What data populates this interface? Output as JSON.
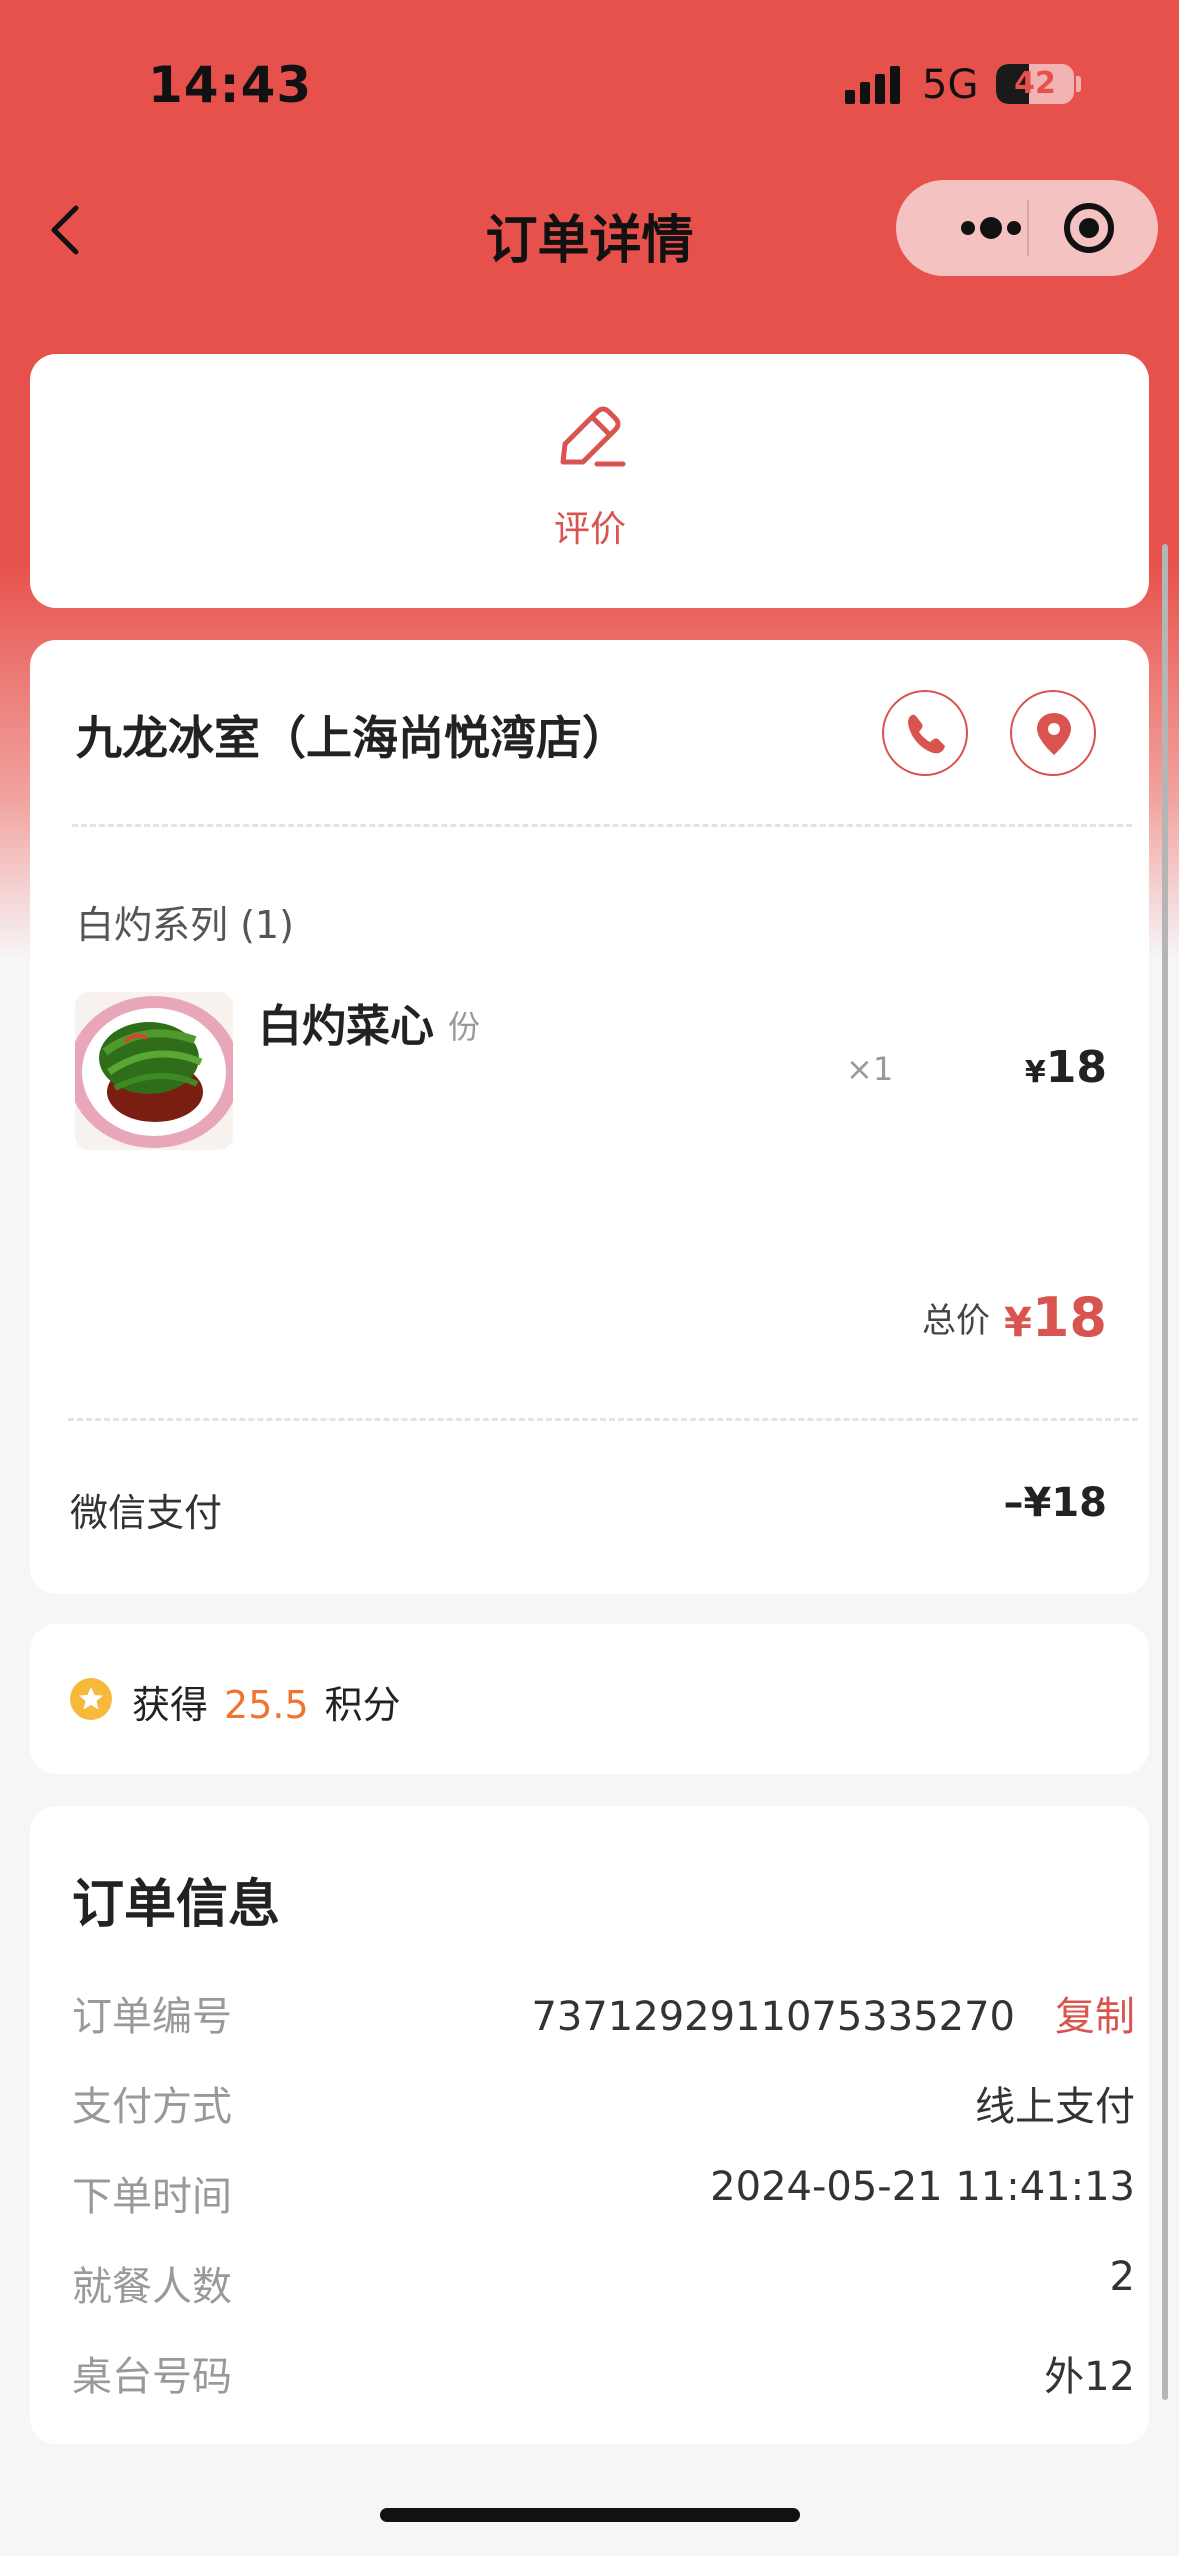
{
  "status_bar": {
    "time": "14:43",
    "network": "5G",
    "battery": "42",
    "battery_level": 0.42
  },
  "nav": {
    "title": "订单详情",
    "back_icon": "chevron-left-icon",
    "more_icon": "more-dots-icon",
    "close_icon": "target-circle-icon"
  },
  "review": {
    "label": "评价",
    "icon": "edit-icon"
  },
  "store": {
    "name": "九龙冰室（上海尚悦湾店）",
    "phone_icon": "phone-icon",
    "location_icon": "location-pin-icon"
  },
  "order_items": {
    "category": "白灼系列 (1)",
    "items": [
      {
        "name": "白灼菜心",
        "unit": "份",
        "qty": "×1",
        "currency": "¥",
        "price": "18"
      }
    ]
  },
  "total": {
    "label": "总价",
    "currency": "¥",
    "value": "18"
  },
  "payment": {
    "method": "微信支付",
    "amount": "–¥18"
  },
  "points": {
    "prefix": "获得",
    "value": "25.5",
    "suffix": "积分",
    "icon": "star-coin-icon"
  },
  "order_info": {
    "title": "订单信息",
    "copy_label": "复制",
    "rows": [
      {
        "label": "订单编号",
        "value": "7371292911075335270"
      },
      {
        "label": "支付方式",
        "value": "线上支付"
      },
      {
        "label": "下单时间",
        "value": "2024-05-21 11:41:13"
      },
      {
        "label": "就餐人数",
        "value": "2"
      },
      {
        "label": "桌台号码",
        "value": "外12"
      }
    ]
  },
  "colors": {
    "brand_red": "#e6514c",
    "accent_red": "#d9534f",
    "points_orange": "#f07330",
    "coin_yellow": "#f6b93b"
  }
}
